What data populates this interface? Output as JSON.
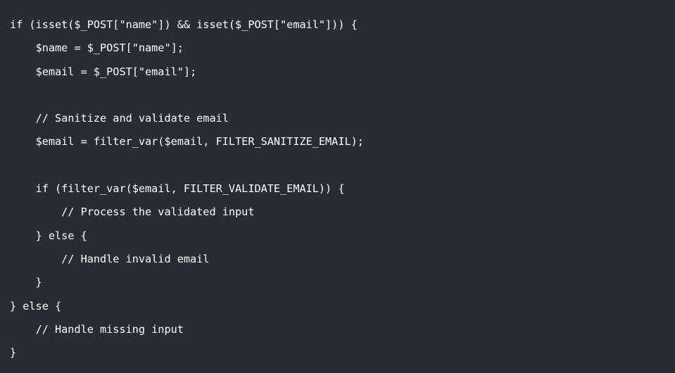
{
  "code": {
    "language": "php",
    "lines": [
      "if (isset($_POST[\"name\"]) && isset($_POST[\"email\"])) {",
      "    $name = $_POST[\"name\"];",
      "    $email = $_POST[\"email\"];",
      "",
      "    // Sanitize and validate email",
      "    $email = filter_var($email, FILTER_SANITIZE_EMAIL);",
      "",
      "    if (filter_var($email, FILTER_VALIDATE_EMAIL)) {",
      "        // Process the validated input",
      "    } else {",
      "        // Handle invalid email",
      "    }",
      "} else {",
      "    // Handle missing input",
      "}"
    ]
  }
}
